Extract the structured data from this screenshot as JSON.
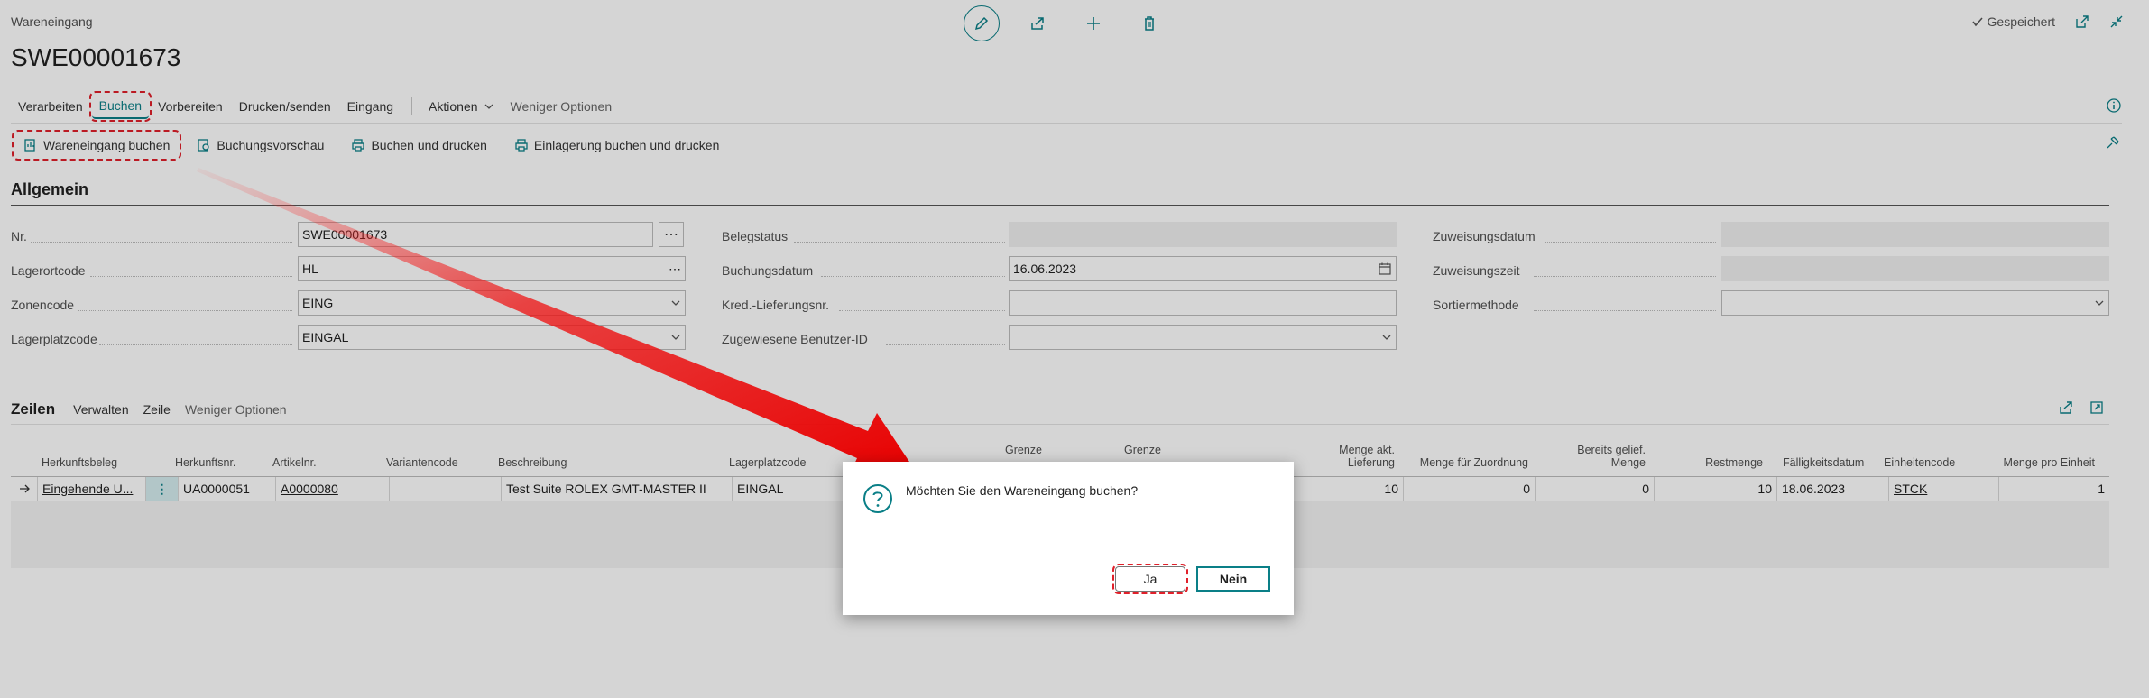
{
  "header": {
    "page_type": "Wareneingang",
    "record_no": "SWE00001673",
    "saved_label": "Gespeichert"
  },
  "actions": {
    "verarbeiten": "Verarbeiten",
    "buchen": "Buchen",
    "vorbereiten": "Vorbereiten",
    "drucken": "Drucken/senden",
    "eingang": "Eingang",
    "aktionen": "Aktionen",
    "weniger": "Weniger Optionen"
  },
  "subactions": {
    "wareneingang_buchen": "Wareneingang buchen",
    "buchungsvorschau": "Buchungsvorschau",
    "buchen_drucken": "Buchen und drucken",
    "einlagerung": "Einlagerung buchen und drucken"
  },
  "general": {
    "title": "Allgemein",
    "nr_label": "Nr.",
    "nr_value": "SWE00001673",
    "lagerortcode_label": "Lagerortcode",
    "lagerortcode_value": "HL",
    "zonencode_label": "Zonencode",
    "zonencode_value": "EING",
    "lagerplatzcode_label": "Lagerplatzcode",
    "lagerplatzcode_value": "EINGAL",
    "belegstatus_label": "Belegstatus",
    "buchungsdatum_label": "Buchungsdatum",
    "buchungsdatum_value": "16.06.2023",
    "kred_label": "Kred.-Lieferungsnr.",
    "benutzer_label": "Zugewiesene Benutzer-ID",
    "zuweisungsdatum_label": "Zuweisungsdatum",
    "zuweisungszeit_label": "Zuweisungszeit",
    "sortiermethode_label": "Sortiermethode"
  },
  "lines": {
    "title": "Zeilen",
    "verwalten": "Verwalten",
    "zeile": "Zeile",
    "weniger": "Weniger Optionen",
    "columns": {
      "herkunftsbeleg": "Herkunftsbeleg",
      "herkunftsnr": "Herkunftsnr.",
      "artikelnr": "Artikelnr.",
      "variantencode": "Variantencode",
      "beschreibung": "Beschreibung",
      "lagerplatzcode": "Lagerplatzcode",
      "grenze1": "Grenze",
      "grenze2": "Grenze",
      "menge_akt_1": "Menge akt.",
      "menge_akt_2": "Lieferung",
      "menge_zuordnung": "Menge für Zuordnung",
      "bereits_1": "Bereits gelief.",
      "bereits_2": "Menge",
      "restmenge": "Restmenge",
      "faelligkeit": "Fälligkeitsdatum",
      "einheitencode": "Einheitencode",
      "menge_pro_einheit": "Menge pro Einheit"
    },
    "row": {
      "herkunftsbeleg": "Eingehende U...",
      "herkunftsnr": "UA0000051",
      "artikelnr": "A0000080",
      "variantencode": "",
      "beschreibung": "Test Suite ROLEX GMT-MASTER II",
      "lagerplatzcode": "EINGAL",
      "menge_akt": "10",
      "menge_zuordnung": "0",
      "bereits": "0",
      "restmenge": "10",
      "faelligkeit": "18.06.2023",
      "einheitencode": "STCK",
      "menge_pro_einheit": "1"
    }
  },
  "dialog": {
    "message": "Möchten Sie den Wareneingang buchen?",
    "yes": "Ja",
    "no": "Nein"
  },
  "colors": {
    "accent": "#0a7f87",
    "highlight": "#e0202a"
  }
}
